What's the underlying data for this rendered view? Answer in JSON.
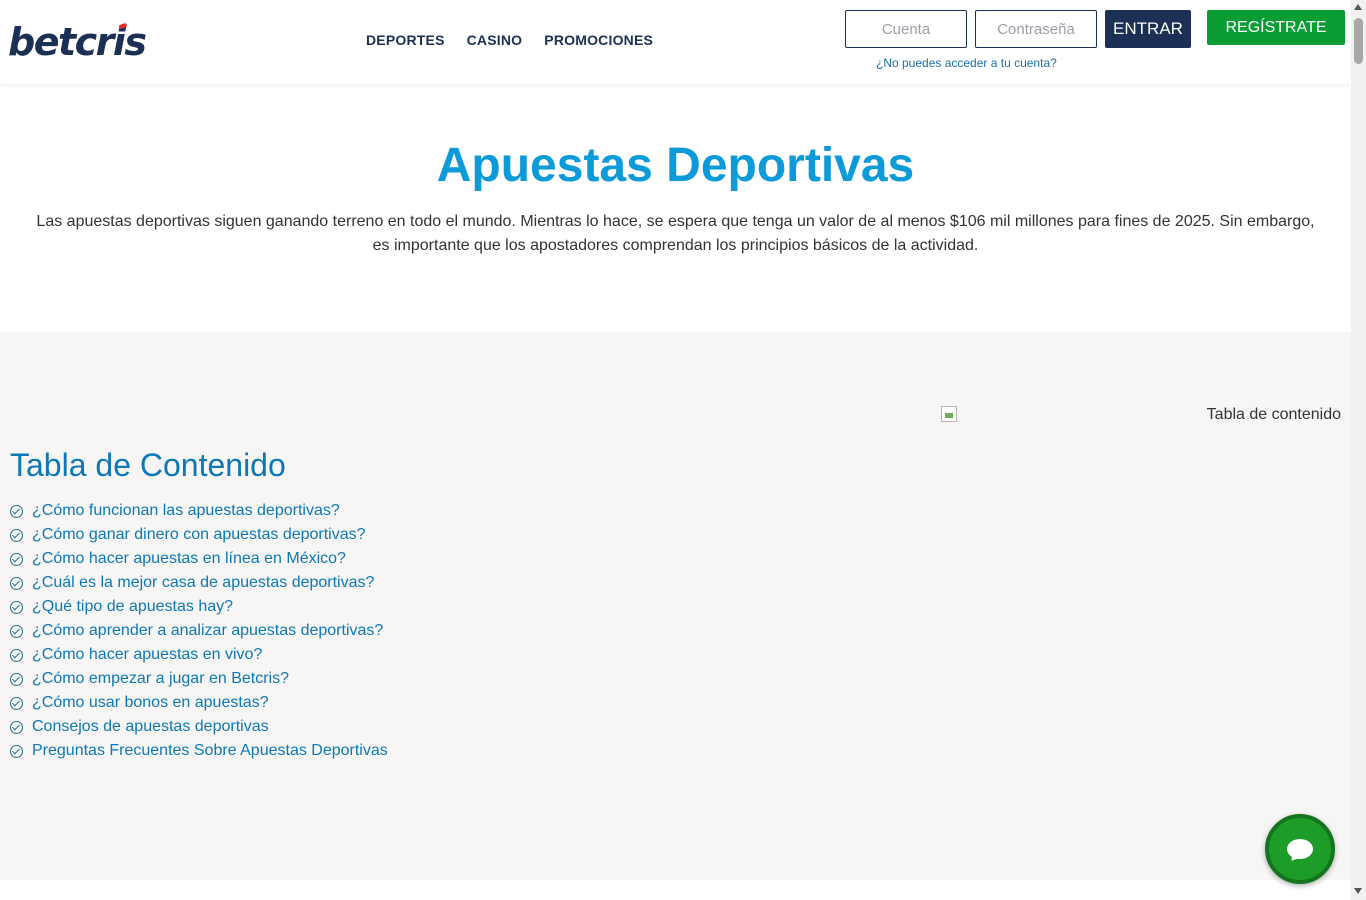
{
  "header": {
    "logo": "betcris",
    "nav": [
      "DEPORTES",
      "CASINO",
      "PROMOCIONES"
    ],
    "account_placeholder": "Cuenta",
    "password_placeholder": "Contraseña",
    "login_label": "ENTRAR",
    "register_label": "REGÍSTRATE",
    "forgot_link": "¿No puedes acceder a tu cuenta?"
  },
  "hero": {
    "title": "Apuestas Deportivas",
    "intro": "Las apuestas deportivas siguen ganando terreno en todo el mundo. Mientras lo hace, se espera que tenga un valor de al menos $106 mil millones para fines de 2025. Sin embargo, es importante que los apostadores comprendan los principios básicos de la actividad."
  },
  "toc": {
    "image_alt": "Tabla de contenido",
    "title": "Tabla de Contenido",
    "items": [
      "¿Cómo funcionan las apuestas deportivas?",
      "¿Cómo ganar dinero con apuestas deportivas?",
      "¿Cómo hacer apuestas en línea en México?",
      "¿Cuál es la mejor casa de apuestas deportivas?",
      "¿Qué tipo de apuestas hay?",
      "¿Cómo aprender a analizar apuestas deportivas?",
      "¿Cómo hacer apuestas en vivo?",
      "¿Cómo empezar a jugar en Betcris?",
      "¿Cómo usar bonos en apuestas?",
      "Consejos de apuestas deportivas",
      "Preguntas Frecuentes Sobre Apuestas Deportivas"
    ]
  },
  "colors": {
    "brand_navy": "#1c2f55",
    "accent_blue": "#0c9bd8",
    "link_blue": "#0c78b8",
    "register_green": "#0a9d34",
    "chat_green": "#1e9c2a"
  },
  "icons": {
    "toc_bullet": "check-circle-icon",
    "chat": "chat-bubble-icon"
  }
}
